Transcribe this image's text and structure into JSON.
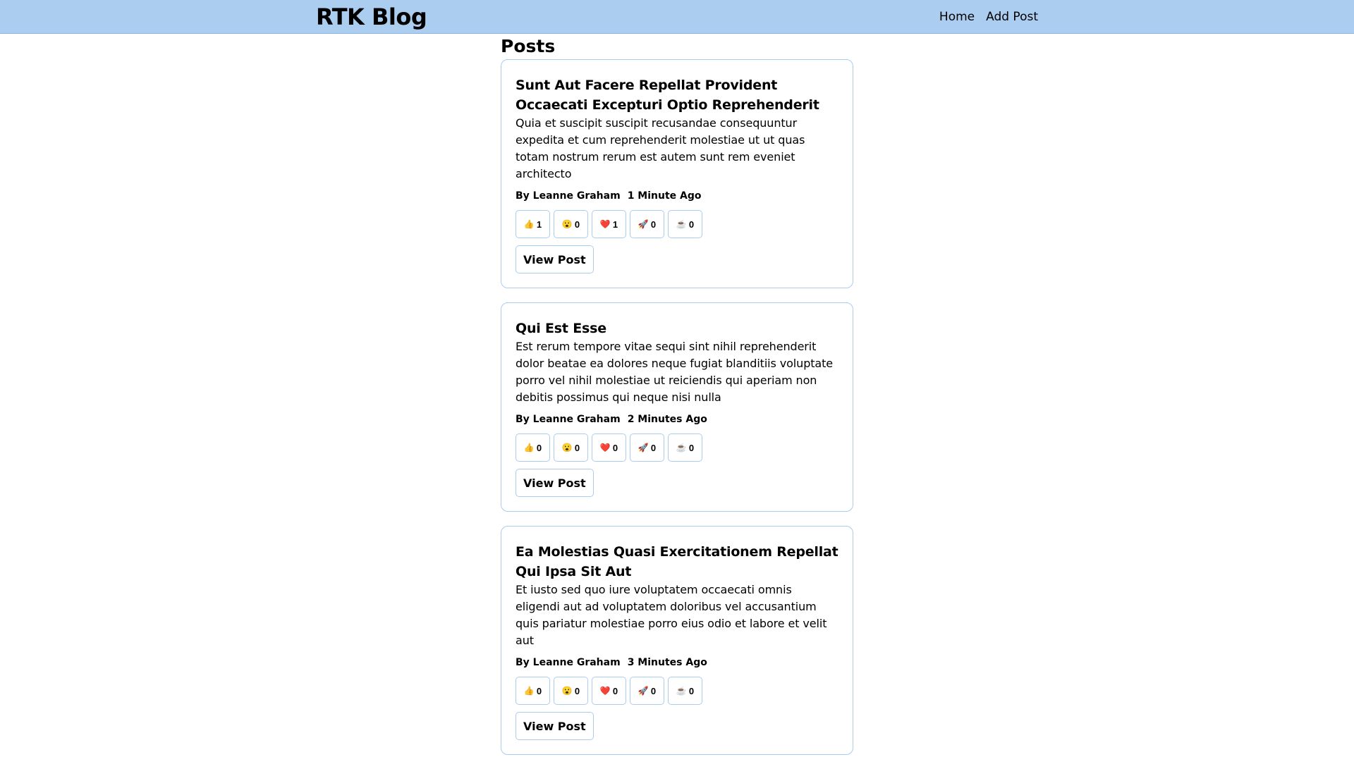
{
  "header": {
    "brand": "RTK Blog",
    "nav": [
      {
        "label": "Home"
      },
      {
        "label": "Add Post"
      }
    ]
  },
  "main": {
    "title": "Posts",
    "view_label": "View Post",
    "posts": [
      {
        "title": "Sunt Aut Facere Repellat Provident Occaecati Excepturi Optio Reprehenderit",
        "body": "Quia et suscipit suscipit recusandae consequuntur expedita et cum reprehenderit molestiae ut ut quas totam nostrum rerum est autem sunt rem eveniet architecto",
        "author": "By Leanne Graham",
        "time": "1 Minute Ago",
        "reactions": [
          {
            "emoji": "👍",
            "icon": "thumbs-up-icon",
            "count": "1"
          },
          {
            "emoji": "😮",
            "icon": "wow-face-icon",
            "count": "0"
          },
          {
            "emoji": "❤️",
            "icon": "heart-icon",
            "count": "1"
          },
          {
            "emoji": "🚀",
            "icon": "rocket-icon",
            "count": "0"
          },
          {
            "emoji": "☕",
            "icon": "coffee-icon",
            "count": "0"
          }
        ]
      },
      {
        "title": "Qui Est Esse",
        "body": "Est rerum tempore vitae sequi sint nihil reprehenderit dolor beatae ea dolores neque fugiat blanditiis voluptate porro vel nihil molestiae ut reiciendis qui aperiam non debitis possimus qui neque nisi nulla",
        "author": "By Leanne Graham",
        "time": "2 Minutes Ago",
        "reactions": [
          {
            "emoji": "👍",
            "icon": "thumbs-up-icon",
            "count": "0"
          },
          {
            "emoji": "😮",
            "icon": "wow-face-icon",
            "count": "0"
          },
          {
            "emoji": "❤️",
            "icon": "heart-icon",
            "count": "0"
          },
          {
            "emoji": "🚀",
            "icon": "rocket-icon",
            "count": "0"
          },
          {
            "emoji": "☕",
            "icon": "coffee-icon",
            "count": "0"
          }
        ]
      },
      {
        "title": "Ea Molestias Quasi Exercitationem Repellat Qui Ipsa Sit Aut",
        "body": "Et iusto sed quo iure voluptatem occaecati omnis eligendi aut ad voluptatem doloribus vel accusantium quis pariatur molestiae porro eius odio et labore et velit aut",
        "author": "By Leanne Graham",
        "time": "3 Minutes Ago",
        "reactions": [
          {
            "emoji": "👍",
            "icon": "thumbs-up-icon",
            "count": "0"
          },
          {
            "emoji": "😮",
            "icon": "wow-face-icon",
            "count": "0"
          },
          {
            "emoji": "❤️",
            "icon": "heart-icon",
            "count": "0"
          },
          {
            "emoji": "🚀",
            "icon": "rocket-icon",
            "count": "0"
          },
          {
            "emoji": "☕",
            "icon": "coffee-icon",
            "count": "0"
          }
        ]
      }
    ]
  },
  "colors": {
    "header_bg": "#abcdf0",
    "border": "#abcdf0"
  }
}
